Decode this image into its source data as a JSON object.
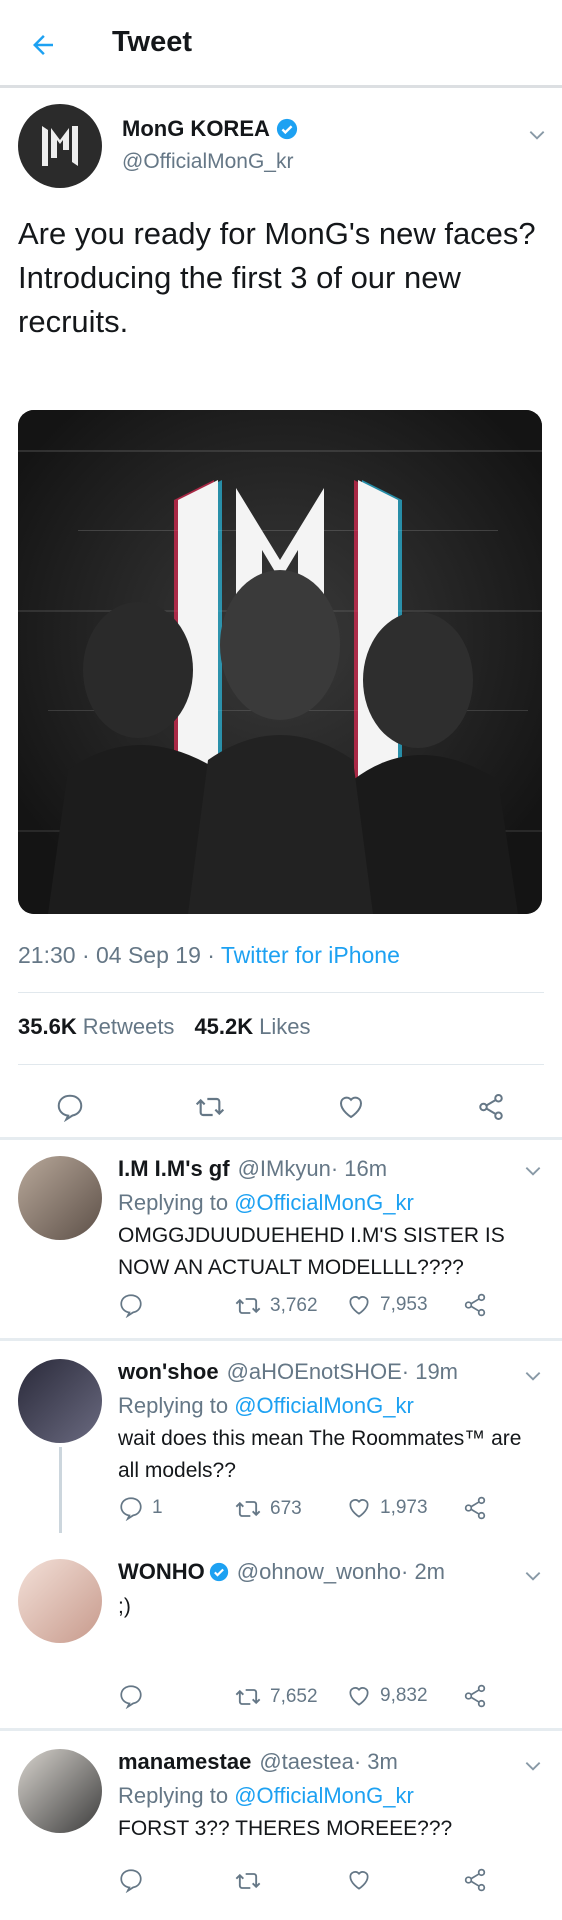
{
  "header": {
    "title": "Tweet"
  },
  "tweet": {
    "author_name": "MonG KOREA",
    "author_handle": "@OfficialMonG_kr",
    "text": "Are you ready for MonG's new faces?\nIntroducing the first 3 of our new recruits.",
    "time": "21:30 · 04 Sep 19 · ",
    "source": "Twitter for iPhone",
    "retweets_count": "35.6K",
    "retweets_label": "Retweets",
    "likes_count": "45.2K",
    "likes_label": "Likes"
  },
  "replies": [
    {
      "name": "I.M I.M's gf",
      "handle": "@IMkyun",
      "time": " · 16m",
      "replying_prefix": "Replying to ",
      "replying_to": "@OfficialMonG_kr",
      "text": "OMGGJDUUDUEHEHD I.M'S SISTER IS NOW AN ACTUALT MODELLLL????",
      "retweets": "3,762",
      "likes": "7,953"
    },
    {
      "name": "won'shoe",
      "handle": "@aHOEnotSHOE",
      "time": " · 19m",
      "replying_prefix": "Replying to ",
      "replying_to": "@OfficialMonG_kr",
      "text": "wait does this mean The Roommates™ are all models??",
      "comments": "1",
      "retweets": "673",
      "likes": "1,973"
    },
    {
      "name": "WONHO",
      "handle": "@ohnow_wonho",
      "time": " · 2m",
      "text": ";)",
      "retweets": "7,652",
      "likes": "9,832"
    },
    {
      "name": "manamestae",
      "handle": "@taestea",
      "time": " · 3m",
      "replying_prefix": "Replying to ",
      "replying_to": "@OfficialMonG_kr",
      "text": "FORST 3?? THERES MOREEE???"
    }
  ],
  "colors": {
    "accent": "#1da1f2",
    "text": "#14171a",
    "secondary": "#657786",
    "divider": "#e1e8ed"
  },
  "icons": [
    "back-arrow-icon",
    "verified-icon",
    "chevron-down-icon",
    "comment-icon",
    "retweet-icon",
    "heart-icon",
    "share-icon"
  ]
}
